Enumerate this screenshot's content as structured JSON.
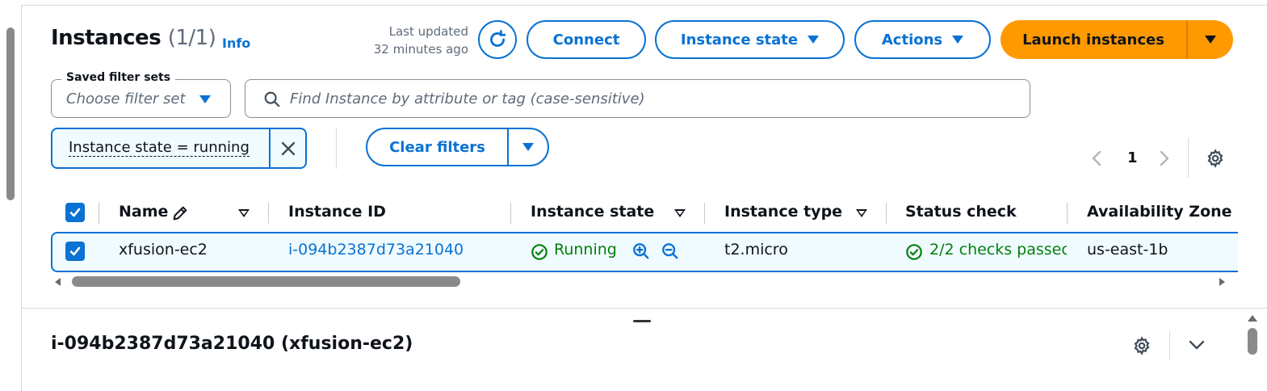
{
  "header": {
    "title": "Instances",
    "count": "(1/1)",
    "info": "Info",
    "last_updated_line1": "Last updated",
    "last_updated_line2": "32 minutes ago",
    "connect": "Connect",
    "instance_state": "Instance state",
    "actions": "Actions",
    "launch": "Launch instances"
  },
  "filters": {
    "saved_label": "Saved filter sets",
    "saved_placeholder": "Choose filter set",
    "search_placeholder": "Find Instance by attribute or tag (case-sensitive)",
    "token": "Instance state = running",
    "clear": "Clear filters"
  },
  "pagination": {
    "prev": "<",
    "page": "1",
    "next": ">"
  },
  "table": {
    "columns": [
      "Name",
      "Instance ID",
      "Instance state",
      "Instance type",
      "Status check",
      "Availability Zone"
    ],
    "rows": [
      {
        "name": "xfusion-ec2",
        "instance_id": "i-094b2387d73a21040",
        "state": "Running",
        "type": "t2.micro",
        "status": "2/2 checks passec",
        "az": "us-east-1b"
      }
    ]
  },
  "detail": {
    "title": "i-094b2387d73a21040 (xfusion-ec2)"
  },
  "colors": {
    "accent": "#0972d3",
    "launch": "#ff9900",
    "success": "#037f0c",
    "row_selected": "#f0fbff"
  },
  "icons": [
    "refresh-icon",
    "caret-down-icon",
    "search-icon",
    "close-icon",
    "settings-icon",
    "edit-icon",
    "sort-icon",
    "check-circle-icon",
    "zoom-in-icon",
    "zoom-out-icon",
    "chevron-down-icon"
  ]
}
